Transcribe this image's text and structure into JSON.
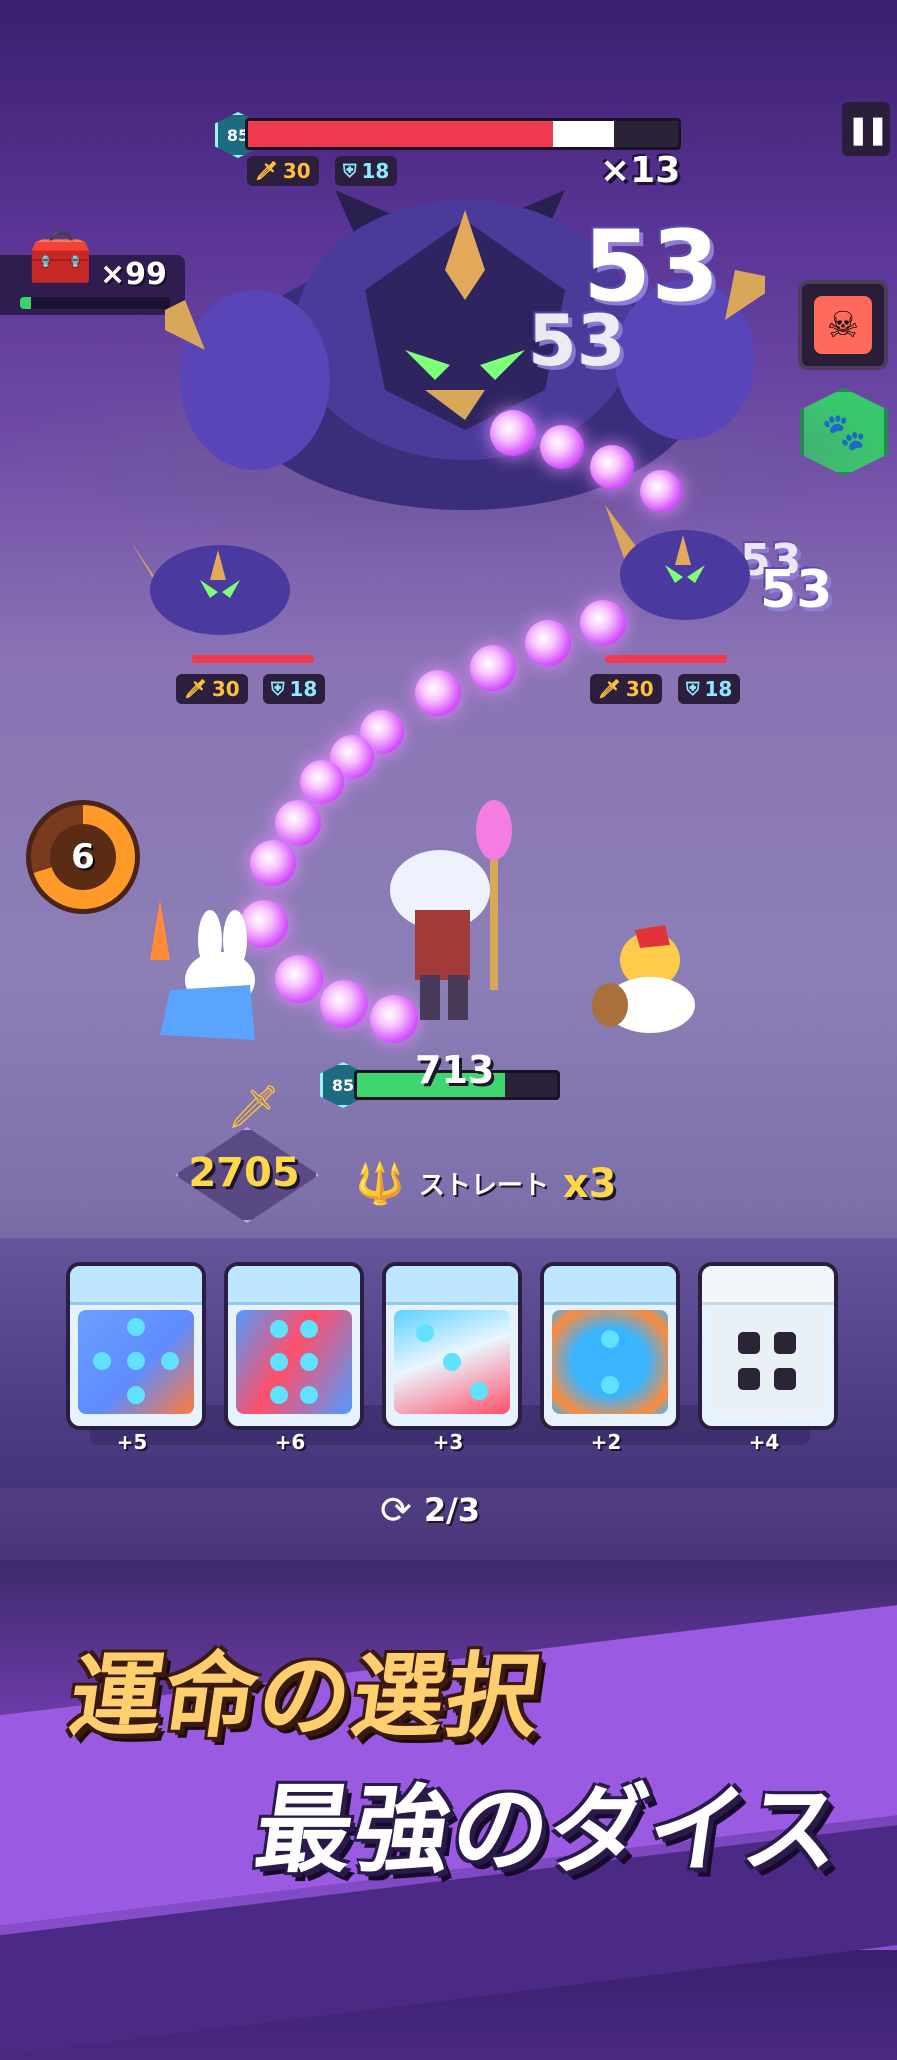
{
  "boss": {
    "level": "85",
    "hp_fraction": 0.71,
    "shield_fraction": 0.85,
    "attack": "30",
    "defense": "18",
    "multiplier": "×13"
  },
  "damage_numbers": {
    "big": "53",
    "mid": "53",
    "right_small": "53",
    "right_big": "53"
  },
  "chest": {
    "icon": "treasure-chest-icon",
    "count": "×99",
    "progress_fraction": 0.07
  },
  "minions": [
    {
      "attack": "30",
      "defense": "18",
      "hp_fraction": 1.0
    },
    {
      "attack": "30",
      "defense": "18",
      "hp_fraction": 1.0
    }
  ],
  "turn_timer": {
    "value": "6"
  },
  "hero": {
    "level": "85",
    "hp": "713",
    "hp_fraction": 0.74
  },
  "power": {
    "value": "2705"
  },
  "combo": {
    "label": "ストレート",
    "multiplier": "x3"
  },
  "dice": [
    {
      "label": "+5",
      "colors": [
        "#5e8cff",
        "#ff7a3a"
      ]
    },
    {
      "label": "+6",
      "colors": [
        "#ff4f6a",
        "#4f9cff"
      ]
    },
    {
      "label": "+3",
      "colors": [
        "#5bd0ff",
        "#ff4f6a"
      ]
    },
    {
      "label": "+2",
      "colors": [
        "#3ab4ff",
        "#ff8a3a"
      ]
    },
    {
      "label": "+4",
      "colors": [
        "#e9f0f6",
        "#2a2536"
      ]
    }
  ],
  "reroll": {
    "text": "2/3"
  },
  "slogan": {
    "line1": "運命の選択",
    "line2": "最強のダイス"
  },
  "colors": {
    "hp_red": "#f0384f",
    "hp_green": "#3ed66e",
    "gold": "#ffd84a",
    "magic": "#d24cff"
  }
}
